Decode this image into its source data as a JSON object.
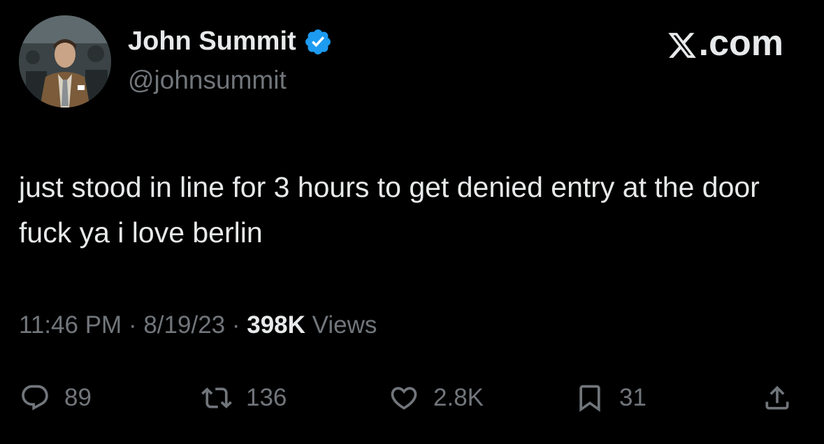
{
  "author": {
    "display_name": "John Summit",
    "handle": "@johnsummit",
    "verified": true
  },
  "brand": {
    "label": ".com",
    "icon": "x-logo-icon"
  },
  "tweet": {
    "text": "just stood in line for 3 hours to get denied entry at the door fuck ya i love berlin",
    "time": "11:46 PM",
    "date": "8/19/23",
    "views_count": "398K",
    "views_label": "Views"
  },
  "actions": {
    "replies": "89",
    "reposts": "136",
    "likes": "2.8K",
    "bookmarks": "31"
  },
  "colors": {
    "background": "#000000",
    "primary_text": "#e7e9ea",
    "secondary_text": "#71767b",
    "verified_badge": "#1d9bf0"
  }
}
